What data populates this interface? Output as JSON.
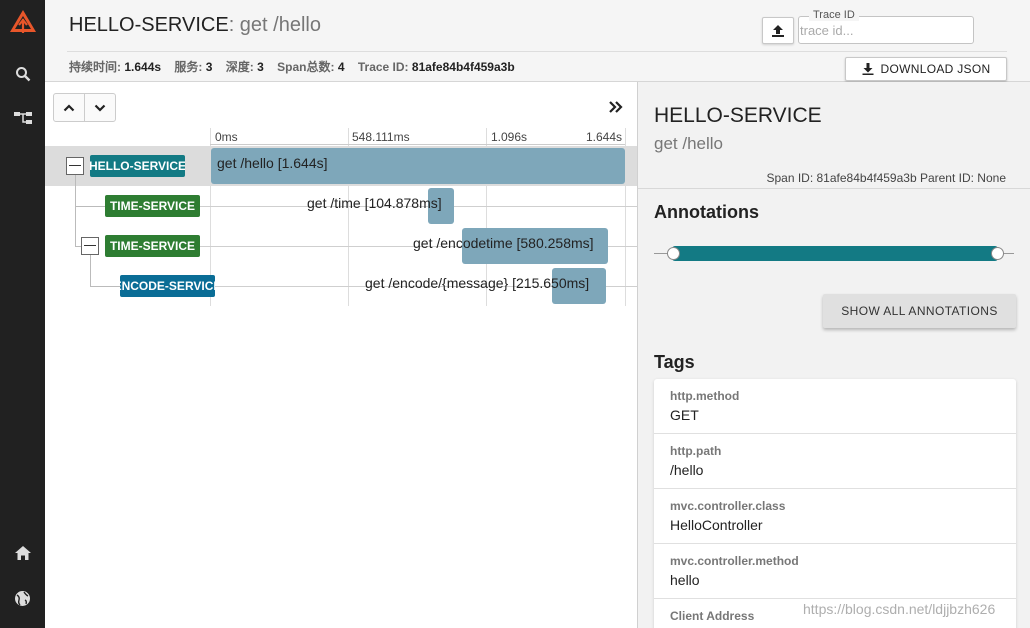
{
  "sidebar": {
    "items": [
      {
        "icon": "zipkin-logo-icon"
      },
      {
        "icon": "search-icon"
      },
      {
        "icon": "dependencies-icon"
      },
      {
        "icon": "home-icon"
      },
      {
        "icon": "globe-icon"
      }
    ]
  },
  "header": {
    "service": "HELLO-SERVICE",
    "separator": ":",
    "span_name": " get /hello",
    "stats": [
      {
        "label": "持续时间:",
        "value": "1.644s"
      },
      {
        "label": "服务:",
        "value": "3"
      },
      {
        "label": "深度:",
        "value": "3"
      },
      {
        "label": "Span总数:",
        "value": "4"
      },
      {
        "label": "Trace ID:",
        "value": "81afe84b4f459a3b"
      }
    ],
    "trace_id_label": "Trace ID",
    "trace_id_placeholder": "trace id...",
    "download_label": "DOWNLOAD JSON"
  },
  "timeline": {
    "ticks": [
      "0ms",
      "548.111ms",
      "1.096s",
      "1.644s"
    ],
    "spans": [
      {
        "service": "HELLO-SERVICE",
        "label": "get /hello [1.644s]",
        "color": "#137a84"
      },
      {
        "service": "TIME-SERVICE",
        "label": "get /time [104.878ms]",
        "color": "#2e7d32"
      },
      {
        "service": "TIME-SERVICE",
        "label": "get /encodetime [580.258ms]",
        "color": "#2e7d32"
      },
      {
        "service": "ENCODE-SERVICE",
        "label": "get /encode/{message} [215.650ms]",
        "color": "#0a6d96"
      }
    ]
  },
  "detail": {
    "service": "HELLO-SERVICE",
    "span_name": "get /hello",
    "ids": "Span ID: 81afe84b4f459a3b   Parent ID: None",
    "annotations_title": "Annotations",
    "show_annotations_label": "SHOW ALL ANNOTATIONS",
    "tags_title": "Tags",
    "tags": [
      {
        "key": "http.method",
        "value": "GET"
      },
      {
        "key": "http.path",
        "value": "/hello"
      },
      {
        "key": "mvc.controller.class",
        "value": "HelloController"
      },
      {
        "key": "mvc.controller.method",
        "value": "hello"
      },
      {
        "key": "Client Address",
        "value": ""
      }
    ]
  },
  "watermark": "https://blog.csdn.net/ldjjbzh626"
}
